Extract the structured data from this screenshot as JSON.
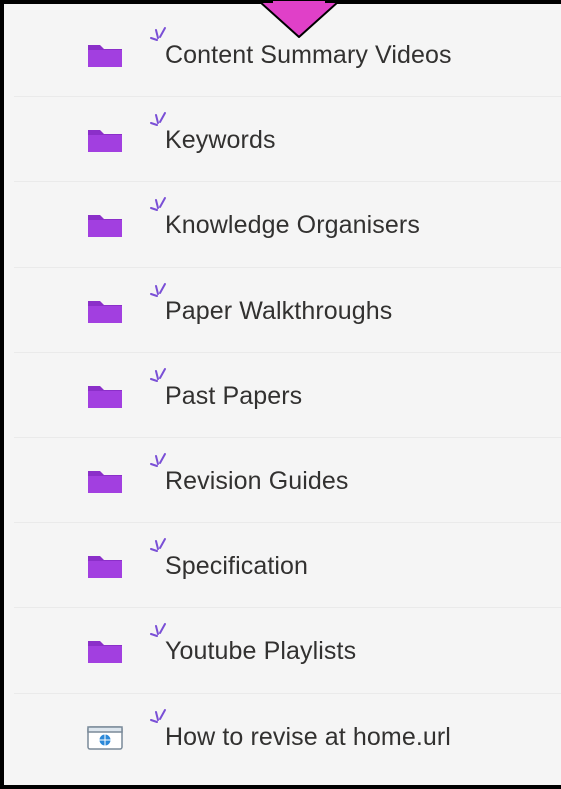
{
  "accent_color": "#8b2fc9",
  "items": [
    {
      "label": "Content Summary Videos",
      "type": "folder",
      "icon": "folder-icon"
    },
    {
      "label": "Keywords",
      "type": "folder",
      "icon": "folder-icon"
    },
    {
      "label": "Knowledge Organisers",
      "type": "folder",
      "icon": "folder-icon"
    },
    {
      "label": "Paper Walkthroughs",
      "type": "folder",
      "icon": "folder-icon"
    },
    {
      "label": "Past Papers",
      "type": "folder",
      "icon": "folder-icon"
    },
    {
      "label": "Revision Guides",
      "type": "folder",
      "icon": "folder-icon"
    },
    {
      "label": "Specification",
      "type": "folder",
      "icon": "folder-icon"
    },
    {
      "label": "Youtube Playlists",
      "type": "folder",
      "icon": "folder-icon"
    },
    {
      "label": "How to revise at home.url",
      "type": "link",
      "icon": "web-link-file-icon"
    }
  ]
}
